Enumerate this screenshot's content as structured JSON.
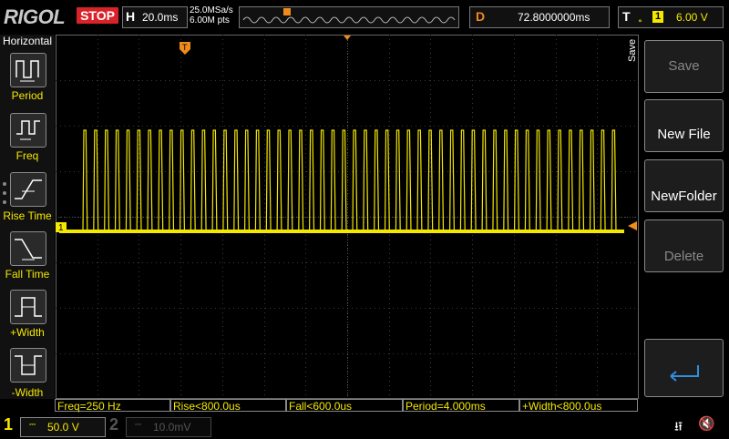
{
  "brand": "RIGOL",
  "run_state": "STOP",
  "horizontal": {
    "label": "H",
    "timebase": "20.0ms",
    "sample_rate": "25.0MSa/s",
    "memory_depth": "6.00M pts"
  },
  "delay": {
    "label": "D",
    "value": "72.8000000ms"
  },
  "trigger": {
    "label": "T",
    "edge_icon": "rising-edge-icon",
    "source": "1",
    "level": "6.00 V"
  },
  "left_menu": {
    "title": "Horizontal",
    "items": [
      {
        "label": "Period",
        "icon": "period-icon"
      },
      {
        "label": "Freq",
        "icon": "freq-icon"
      },
      {
        "label": "Rise Time",
        "icon": "rise-time-icon"
      },
      {
        "label": "Fall Time",
        "icon": "fall-time-icon"
      },
      {
        "label": "+Width",
        "icon": "plus-width-icon"
      },
      {
        "label": "-Width",
        "icon": "minus-width-icon"
      }
    ]
  },
  "right_menu": {
    "side_label": "Save",
    "buttons": [
      {
        "label": "Save",
        "enabled": false
      },
      {
        "label": "New File",
        "enabled": true
      },
      {
        "label": "NewFolder",
        "enabled": true
      },
      {
        "label": "Delete",
        "enabled": false
      },
      {
        "label": "",
        "icon": "enter-icon",
        "enabled": true
      }
    ]
  },
  "channel_marker": "1",
  "measurements": [
    "Freq=250 Hz",
    "Rise<800.0us",
    "Fall<600.0us",
    "Period=4.000ms",
    "+Width<800.0us"
  ],
  "channels": [
    {
      "number": "1",
      "coupling": "DC",
      "scale": "50.0 V",
      "active": true
    },
    {
      "number": "2",
      "coupling": "DC",
      "scale": "10.0mV",
      "active": false
    }
  ],
  "colors": {
    "ch1": "#f5e800",
    "trigger": "#f08a1c",
    "stop": "#d9232a",
    "grid": "#3a3a3a"
  },
  "status_icons": [
    "usb-icon",
    "speaker-muted-icon"
  ],
  "chart_data": {
    "type": "line",
    "series": [
      {
        "name": "",
        "waveform": "pulse-train",
        "frequency_hz": 250,
        "period_ms": 4.0,
        "pulse_count_visible": 50
      }
    ],
    "grid": true,
    "divisions_x": 14,
    "divisions_y": 8
  }
}
